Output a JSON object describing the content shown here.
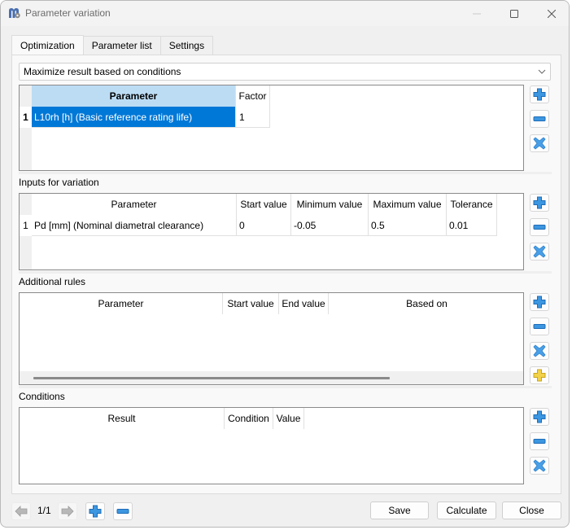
{
  "window": {
    "title": "Parameter variation",
    "app_icon": "app-logo-icon",
    "controls": [
      "minimize-icon",
      "maximize-icon",
      "close-icon"
    ]
  },
  "tabs": [
    {
      "label": "Optimization",
      "active": true
    },
    {
      "label": "Parameter list",
      "active": false
    },
    {
      "label": "Settings",
      "active": false
    }
  ],
  "mode_select": {
    "value": "Maximize result based on conditions"
  },
  "results_table": {
    "columns": [
      "Parameter",
      "Factor"
    ],
    "rows": [
      {
        "index": "1",
        "parameter": "L10rh [h]  (Basic reference rating life)",
        "factor": "1",
        "selected": true
      }
    ]
  },
  "inputs_section": {
    "label": "Inputs for variation",
    "columns": [
      "Parameter",
      "Start value",
      "Minimum value",
      "Maximum value",
      "Tolerance"
    ],
    "rows": [
      {
        "index": "1",
        "parameter": "Pd [mm]  (Nominal diametral clearance)",
        "start": "0",
        "min": "-0.05",
        "max": "0.5",
        "tolerance": "0.01"
      }
    ]
  },
  "rules_section": {
    "label": "Additional rules",
    "columns": [
      "Parameter",
      "Start value",
      "End value",
      "Based on"
    ],
    "rows": []
  },
  "conditions_section": {
    "label": "Conditions",
    "columns": [
      "Result",
      "Condition",
      "Value"
    ],
    "rows": []
  },
  "side_buttons": {
    "add": "plus-icon",
    "remove": "minus-icon",
    "clear": "x-icon",
    "add_special": "yellow-plus-icon"
  },
  "footer": {
    "page_indicator": "1/1",
    "save_label": "Save",
    "calculate_label": "Calculate",
    "close_label": "Close"
  },
  "colors": {
    "selection": "#0078d7",
    "header_highlight": "#bcdcf4",
    "icon_blue": "#2a8ad8",
    "icon_yellow": "#f2d24a"
  }
}
